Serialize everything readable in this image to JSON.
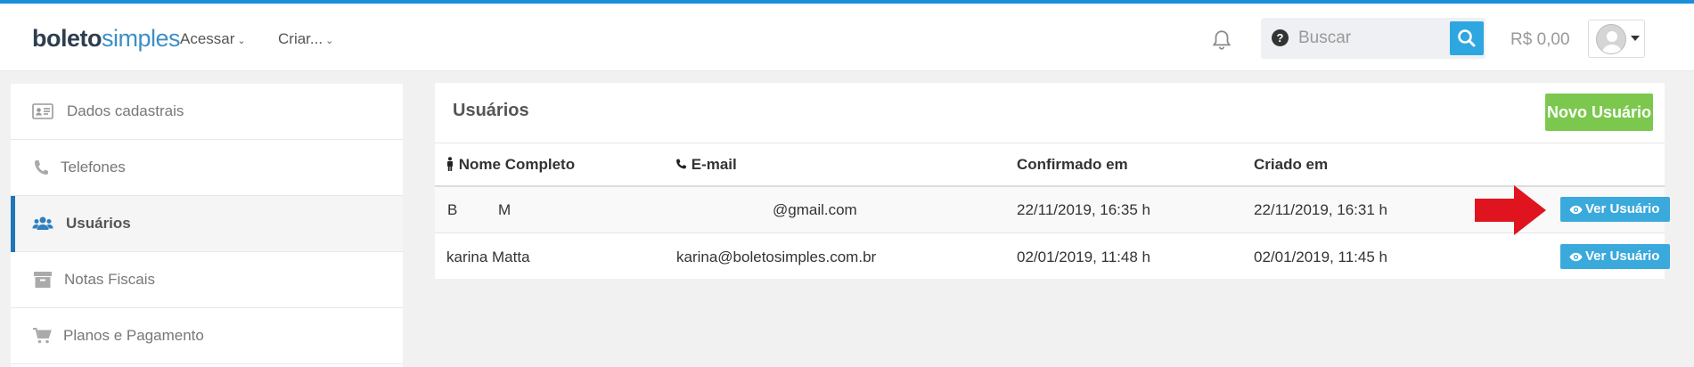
{
  "app": {
    "logo_bold": "boleto",
    "logo_light": "simples"
  },
  "nav": {
    "items": [
      {
        "label": "Acessar"
      },
      {
        "label": "Criar..."
      }
    ]
  },
  "search": {
    "help_glyph": "?",
    "placeholder": "Buscar"
  },
  "header": {
    "balance": "R$ 0,00"
  },
  "sidebar": {
    "items": [
      {
        "label": "Dados cadastrais",
        "icon": "id-card-icon",
        "active": false
      },
      {
        "label": "Telefones",
        "icon": "phone-icon",
        "active": false
      },
      {
        "label": "Usuários",
        "icon": "users-icon",
        "active": true
      },
      {
        "label": "Notas Fiscais",
        "icon": "archive-box-icon",
        "active": false
      },
      {
        "label": "Planos e Pagamento",
        "icon": "cart-icon",
        "active": false
      }
    ]
  },
  "main": {
    "title": "Usuários",
    "new_button": "Novo Usuário",
    "table": {
      "columns": [
        {
          "label": "Nome Completo",
          "icon": "person-icon"
        },
        {
          "label": "E-mail",
          "icon": "phone-icon"
        },
        {
          "label": "Confirmado em",
          "icon": ""
        },
        {
          "label": "Criado em",
          "icon": ""
        }
      ],
      "rows": [
        {
          "name_first": "B",
          "name_last": "M",
          "email": "@gmail.com",
          "confirmed": "22/11/2019, 16:35 h",
          "created": "22/11/2019, 16:31 h",
          "action": "Ver Usuário"
        },
        {
          "name_first": "karina Matta",
          "name_last": "",
          "email": "karina@boletosimples.com.br",
          "confirmed": "02/01/2019, 11:48 h",
          "created": "02/01/2019, 11:45 h",
          "action": "Ver Usuário"
        }
      ]
    }
  },
  "colors": {
    "accent": "#1a8fd9",
    "primary_button": "#7cc84e",
    "info_button": "#3aa9dc",
    "annotation_arrow": "#e0141e"
  }
}
